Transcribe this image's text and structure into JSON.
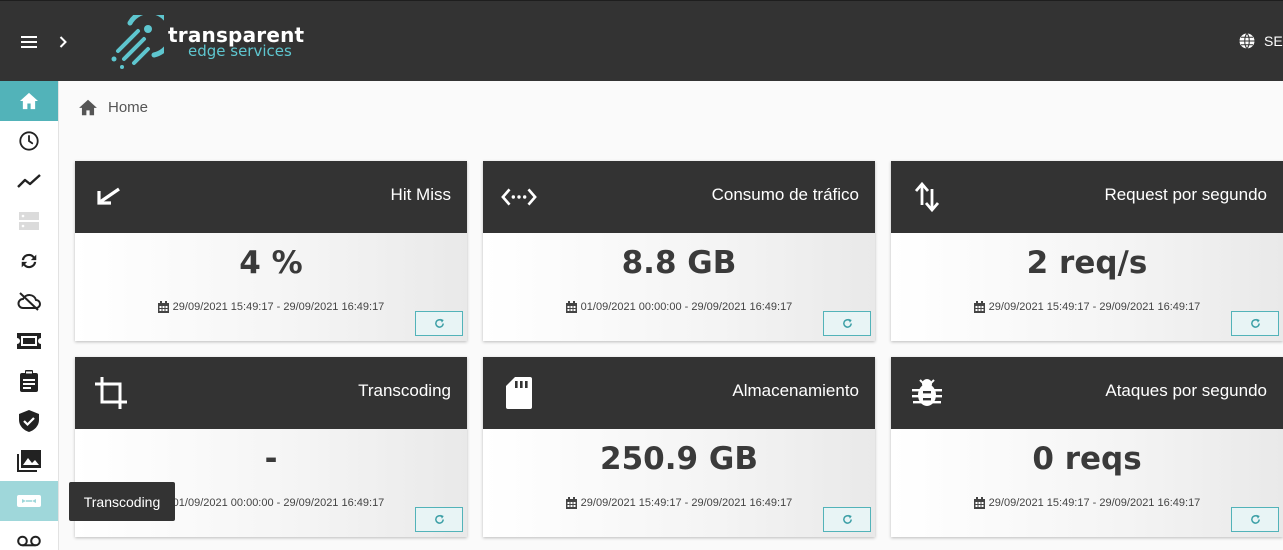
{
  "header": {
    "brand_main": "transparent",
    "brand_sub": "edge services",
    "language_label": "SE"
  },
  "breadcrumb": {
    "home_label": "Home"
  },
  "sidebar": {
    "items": [
      "home",
      "history",
      "trend",
      "servers",
      "sync",
      "cloud-off",
      "ticket",
      "clipboard",
      "shield",
      "photo-library",
      "transcoding",
      "voicemail"
    ],
    "tooltip": "Transcoding"
  },
  "colors": {
    "header_bg": "#333333",
    "accent": "#52b3b9"
  },
  "cards": [
    {
      "title": "Hit Miss",
      "icon": "call-received-icon",
      "value": "4 %",
      "range": "29/09/2021 15:49:17 - 29/09/2021 16:49:17"
    },
    {
      "title": "Consumo de tráfico",
      "icon": "settings-ethernet-icon",
      "value": "8.8 GB",
      "range": "01/09/2021 00:00:00 - 29/09/2021 16:49:17"
    },
    {
      "title": "Request por segundo",
      "icon": "swap-vert-icon",
      "value": "2 req/s",
      "range": "29/09/2021 15:49:17 - 29/09/2021 16:49:17"
    },
    {
      "title": "Transcoding",
      "icon": "crop-icon",
      "value": "-",
      "range": "01/09/2021 00:00:00 - 29/09/2021 16:49:17"
    },
    {
      "title": "Almacenamiento",
      "icon": "sd-card-icon",
      "value": "250.9 GB",
      "range": "29/09/2021 15:49:17 - 29/09/2021 16:49:17"
    },
    {
      "title": "Ataques por segundo",
      "icon": "bug-icon",
      "value": "0 reqs",
      "range": "29/09/2021 15:49:17 - 29/09/2021 16:49:17"
    }
  ]
}
